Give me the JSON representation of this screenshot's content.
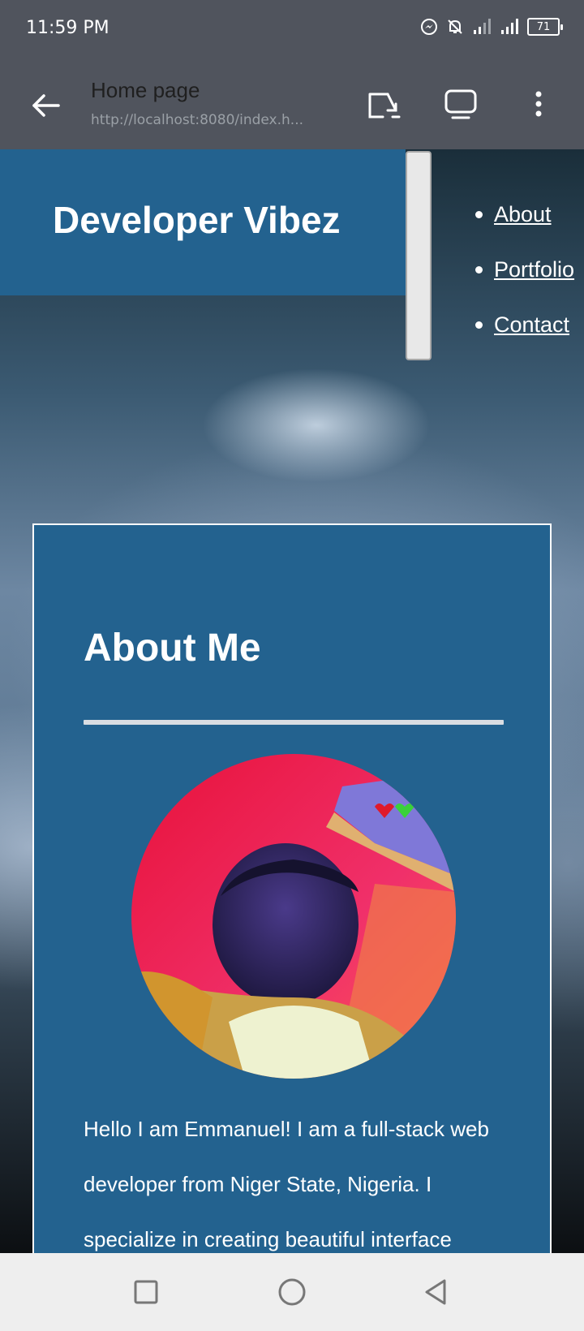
{
  "status_bar": {
    "time": "11:59 PM",
    "battery": "71",
    "icons": [
      "messenger-icon",
      "bell-off-icon",
      "signal-icon",
      "signal-icon",
      "battery-icon"
    ]
  },
  "toolbar": {
    "title": "Home page",
    "url": "http://localhost:8080/index.h...",
    "icons": [
      "back-arrow-icon",
      "open-external-icon",
      "screen-icon",
      "more-vert-icon"
    ]
  },
  "site": {
    "title": "Developer Vibez",
    "nav": [
      "About",
      "Portfolio",
      "Contact"
    ]
  },
  "about": {
    "heading": "About Me",
    "photo": "profile-photo",
    "text": "Hello I am Emmanuel! I am a full-stack web developer from Niger State, Nigeria. I specialize in creating beautiful interface"
  },
  "system_nav": {
    "icons": [
      "recents-square-icon",
      "home-circle-icon",
      "back-triangle-icon"
    ]
  },
  "colors": {
    "header_bg": "#23628f",
    "status_bg": "#50545d",
    "nav_bar_bg": "#eeeeee"
  }
}
